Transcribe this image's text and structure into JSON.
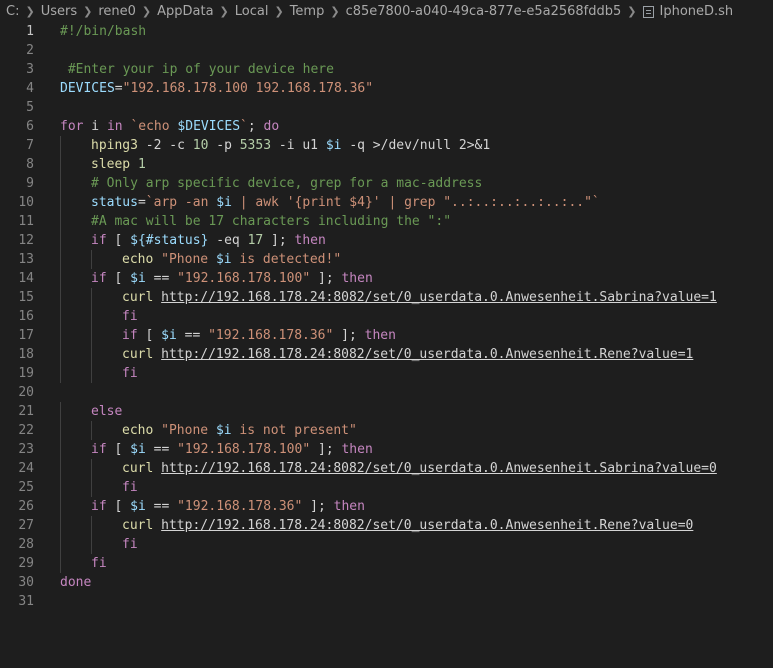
{
  "breadcrumb": {
    "parts": [
      "C:",
      "Users",
      "rene0",
      "AppData",
      "Local",
      "Temp",
      "c85e7800-a040-49ca-877e-e5a2568fddb5"
    ],
    "file": "IphoneD.sh"
  },
  "editor": {
    "active_line": 1,
    "lines": [
      {
        "n": "1",
        "indent": 0,
        "t": [
          [
            "cm",
            "#!/bin/bash"
          ]
        ]
      },
      {
        "n": "2",
        "indent": 0,
        "t": []
      },
      {
        "n": "3",
        "indent": 0,
        "t": [
          [
            "cm",
            " #Enter your ip of your device here"
          ]
        ]
      },
      {
        "n": "4",
        "indent": 0,
        "t": [
          [
            "vr",
            "DEVICES"
          ],
          [
            "",
            "="
          ],
          [
            "st",
            "\"192.168.178.100 192.168.178.36\""
          ]
        ]
      },
      {
        "n": "5",
        "indent": 0,
        "t": []
      },
      {
        "n": "6",
        "indent": 0,
        "t": [
          [
            "kw",
            "for"
          ],
          [
            "",
            " i "
          ],
          [
            "kw",
            "in"
          ],
          [
            "",
            " "
          ],
          [
            "st",
            "`echo "
          ],
          [
            "vr",
            "$DEVICES"
          ],
          [
            "st",
            "`"
          ],
          [
            "",
            "; "
          ],
          [
            "kw",
            "do"
          ]
        ]
      },
      {
        "n": "7",
        "indent": 1,
        "t": [
          [
            "fn",
            "hping3"
          ],
          [
            "",
            " -2 -c "
          ],
          [
            "nm",
            "10"
          ],
          [
            "",
            " -p "
          ],
          [
            "nm",
            "5353"
          ],
          [
            "",
            " -i u1 "
          ],
          [
            "vr",
            "$i"
          ],
          [
            "",
            " -q >/dev/null 2>&1"
          ]
        ]
      },
      {
        "n": "8",
        "indent": 1,
        "t": [
          [
            "fn",
            "sleep"
          ],
          [
            "",
            " "
          ],
          [
            "nm",
            "1"
          ]
        ]
      },
      {
        "n": "9",
        "indent": 1,
        "t": [
          [
            "cm",
            "# Only arp specific device, grep for a mac-address"
          ]
        ]
      },
      {
        "n": "10",
        "indent": 1,
        "t": [
          [
            "vr",
            "status"
          ],
          [
            "",
            "="
          ],
          [
            "st",
            "`arp -an "
          ],
          [
            "vr",
            "$i"
          ],
          [
            "st",
            " | awk '{print $4}' | grep \"..:..:..:..:..:..\"`"
          ]
        ]
      },
      {
        "n": "11",
        "indent": 1,
        "t": [
          [
            "cm",
            "#A mac will be 17 characters including the \":\""
          ]
        ]
      },
      {
        "n": "12",
        "indent": 1,
        "t": [
          [
            "kw",
            "if"
          ],
          [
            "",
            " [ "
          ],
          [
            "vr",
            "${#status}"
          ],
          [
            "",
            " -eq "
          ],
          [
            "nm",
            "17"
          ],
          [
            "",
            " ]; "
          ],
          [
            "kw",
            "then"
          ]
        ]
      },
      {
        "n": "13",
        "indent": 2,
        "t": [
          [
            "fn",
            "echo"
          ],
          [
            "",
            " "
          ],
          [
            "st",
            "\"Phone "
          ],
          [
            "vr",
            "$i"
          ],
          [
            "st",
            " is detected!\""
          ]
        ]
      },
      {
        "n": "14",
        "indent": 1,
        "t": [
          [
            "kw",
            "if"
          ],
          [
            "",
            " [ "
          ],
          [
            "vr",
            "$i"
          ],
          [
            "",
            " == "
          ],
          [
            "st",
            "\"192.168.178.100\""
          ],
          [
            "",
            " ]; "
          ],
          [
            "kw",
            "then"
          ]
        ]
      },
      {
        "n": "15",
        "indent": 2,
        "t": [
          [
            "fn",
            "curl"
          ],
          [
            "",
            " "
          ],
          [
            "url",
            "http://192.168.178.24:8082/set/0_userdata.0.Anwesenheit.Sabrina?value=1"
          ]
        ]
      },
      {
        "n": "16",
        "indent": 2,
        "t": [
          [
            "kw",
            "fi"
          ]
        ]
      },
      {
        "n": "17",
        "indent": 2,
        "t": [
          [
            "kw",
            "if"
          ],
          [
            "",
            " [ "
          ],
          [
            "vr",
            "$i"
          ],
          [
            "",
            " == "
          ],
          [
            "st",
            "\"192.168.178.36\""
          ],
          [
            "",
            " ]; "
          ],
          [
            "kw",
            "then"
          ]
        ]
      },
      {
        "n": "18",
        "indent": 2,
        "t": [
          [
            "fn",
            "curl"
          ],
          [
            "",
            " "
          ],
          [
            "url",
            "http://192.168.178.24:8082/set/0_userdata.0.Anwesenheit.Rene?value=1"
          ]
        ]
      },
      {
        "n": "19",
        "indent": 2,
        "t": [
          [
            "kw",
            "fi"
          ]
        ]
      },
      {
        "n": "20",
        "indent": 0,
        "t": []
      },
      {
        "n": "21",
        "indent": 1,
        "t": [
          [
            "kw",
            "else"
          ]
        ]
      },
      {
        "n": "22",
        "indent": 2,
        "t": [
          [
            "fn",
            "echo"
          ],
          [
            "",
            " "
          ],
          [
            "st",
            "\"Phone "
          ],
          [
            "vr",
            "$i"
          ],
          [
            "st",
            " is not present\""
          ]
        ]
      },
      {
        "n": "23",
        "indent": 1,
        "t": [
          [
            "kw",
            "if"
          ],
          [
            "",
            " [ "
          ],
          [
            "vr",
            "$i"
          ],
          [
            "",
            " == "
          ],
          [
            "st",
            "\"192.168.178.100\""
          ],
          [
            "",
            " ]; "
          ],
          [
            "kw",
            "then"
          ]
        ]
      },
      {
        "n": "24",
        "indent": 2,
        "t": [
          [
            "fn",
            "curl"
          ],
          [
            "",
            " "
          ],
          [
            "url",
            "http://192.168.178.24:8082/set/0_userdata.0.Anwesenheit.Sabrina?value=0"
          ]
        ]
      },
      {
        "n": "25",
        "indent": 2,
        "t": [
          [
            "kw",
            "fi"
          ]
        ]
      },
      {
        "n": "26",
        "indent": 1,
        "t": [
          [
            "kw",
            "if"
          ],
          [
            "",
            " [ "
          ],
          [
            "vr",
            "$i"
          ],
          [
            "",
            " == "
          ],
          [
            "st",
            "\"192.168.178.36\""
          ],
          [
            "",
            " ]; "
          ],
          [
            "kw",
            "then"
          ]
        ]
      },
      {
        "n": "27",
        "indent": 2,
        "t": [
          [
            "fn",
            "curl"
          ],
          [
            "",
            " "
          ],
          [
            "url",
            "http://192.168.178.24:8082/set/0_userdata.0.Anwesenheit.Rene?value=0"
          ]
        ]
      },
      {
        "n": "28",
        "indent": 2,
        "t": [
          [
            "kw",
            "fi"
          ]
        ]
      },
      {
        "n": "29",
        "indent": 1,
        "t": [
          [
            "kw",
            "fi"
          ]
        ]
      },
      {
        "n": "30",
        "indent": 0,
        "t": [
          [
            "kw",
            "done"
          ]
        ]
      },
      {
        "n": "31",
        "indent": 0,
        "t": []
      }
    ]
  }
}
